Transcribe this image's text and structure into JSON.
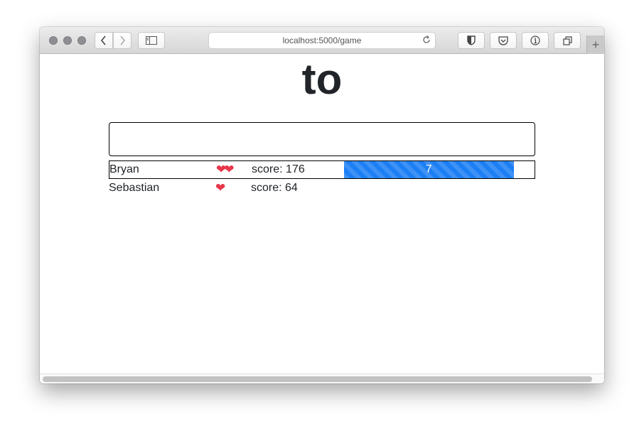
{
  "browser": {
    "url": "localhost:5000/game",
    "back_icon": "‹",
    "forward_icon": "›",
    "new_tab_label": "+"
  },
  "game": {
    "word": "to",
    "answer_input": {
      "value": "",
      "placeholder": ""
    },
    "players": [
      {
        "name": "Bryan",
        "lives": 2,
        "hearts": "❤❤",
        "score_label": "score: 176",
        "active": true,
        "timer": {
          "value_label": "7",
          "fraction_remaining": 0.89
        }
      },
      {
        "name": "Sebastian",
        "lives": 1,
        "hearts": "❤",
        "score_label": "score: 64",
        "active": false
      }
    ]
  },
  "colors": {
    "heart": "#e8364a",
    "timer_bar": "#1c7ff5",
    "title_text": "#212529"
  }
}
